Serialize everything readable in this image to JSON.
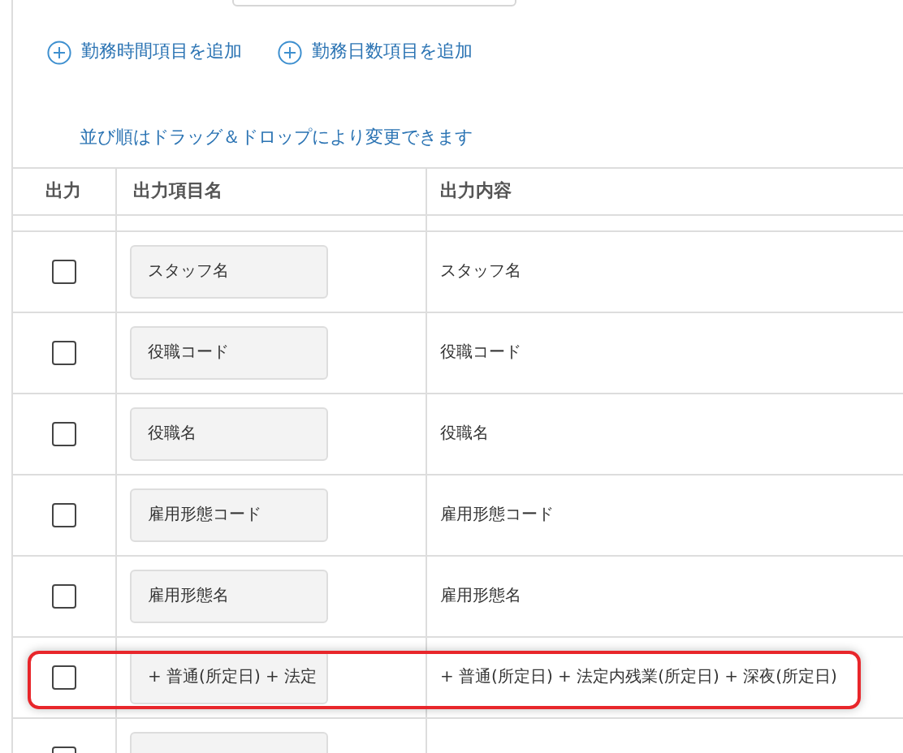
{
  "add_links": [
    {
      "label": "勤務時間項目を追加"
    },
    {
      "label": "勤務日数項目を追加"
    }
  ],
  "note": "並び順はドラッグ＆ドロップにより変更できます",
  "table": {
    "columns": [
      "出力",
      "出力項目名",
      "出力内容"
    ],
    "rows": [
      {
        "checked": false,
        "name": "スタッフ名",
        "content": "スタッフ名",
        "highlighted": false
      },
      {
        "checked": false,
        "name": "役職コード",
        "content": "役職コード",
        "highlighted": false
      },
      {
        "checked": false,
        "name": "役職名",
        "content": "役職名",
        "highlighted": false
      },
      {
        "checked": false,
        "name": "雇用形態コード",
        "content": "雇用形態コード",
        "highlighted": false
      },
      {
        "checked": false,
        "name": "雇用形態名",
        "content": "雇用形態名",
        "highlighted": false
      },
      {
        "checked": false,
        "name": "+ 普通(所定日) + 法定",
        "content": "+ 普通(所定日) + 法定内残業(所定日) + 深夜(所定日)",
        "highlighted": true
      },
      {
        "checked": false,
        "highlighted": false
      }
    ]
  }
}
